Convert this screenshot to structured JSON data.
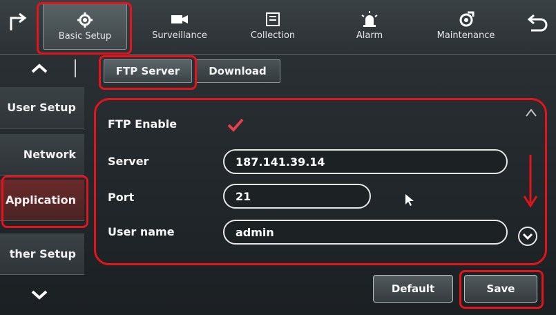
{
  "top_nav": {
    "tabs": [
      {
        "label": "Basic Setup",
        "icon": "gear-icon",
        "active": true
      },
      {
        "label": "Surveillance",
        "icon": "camera-icon"
      },
      {
        "label": "Collection",
        "icon": "storage-icon"
      },
      {
        "label": "Alarm",
        "icon": "alarm-light-icon"
      },
      {
        "label": "Maintenance",
        "icon": "maintenance-icon"
      }
    ],
    "home_icon": "home-icon",
    "back_icon": "back-icon"
  },
  "sidebar": {
    "items": [
      {
        "label": "User Setup"
      },
      {
        "label": "Network"
      },
      {
        "label": "Application",
        "active": true
      },
      {
        "label": "ther Setup"
      }
    ]
  },
  "sub_tabs": [
    {
      "label": "FTP Server",
      "active": true
    },
    {
      "label": "Download"
    }
  ],
  "form": {
    "ftp_enable": {
      "label": "FTP Enable",
      "checked": true
    },
    "server": {
      "label": "Server",
      "value": "187.141.39.14"
    },
    "port": {
      "label": "Port",
      "value": "21"
    },
    "username": {
      "label": "User name",
      "value": "admin"
    }
  },
  "buttons": {
    "default_label": "Default",
    "save_label": "Save"
  },
  "colors": {
    "highlight": "#e4141c",
    "check": "#e8404a"
  }
}
